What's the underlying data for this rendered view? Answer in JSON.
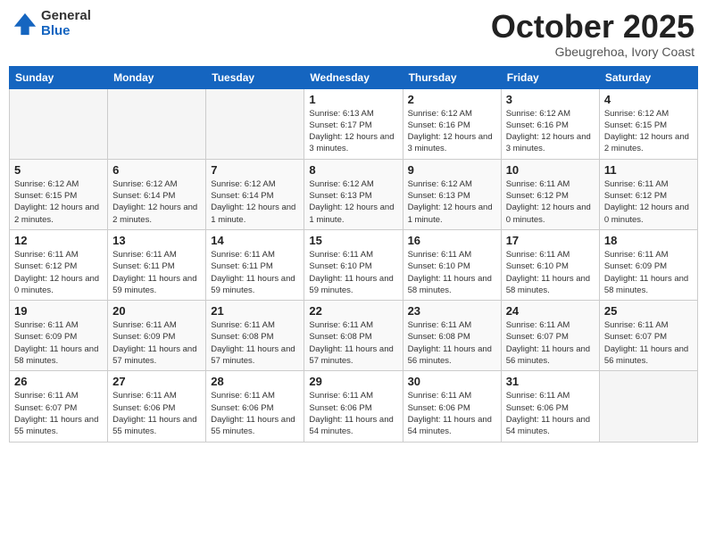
{
  "logo": {
    "general": "General",
    "blue": "Blue"
  },
  "header": {
    "month": "October 2025",
    "location": "Gbeugrehoa, Ivory Coast"
  },
  "weekdays": [
    "Sunday",
    "Monday",
    "Tuesday",
    "Wednesday",
    "Thursday",
    "Friday",
    "Saturday"
  ],
  "weeks": [
    [
      {
        "day": "",
        "sunrise": "",
        "sunset": "",
        "daylight": ""
      },
      {
        "day": "",
        "sunrise": "",
        "sunset": "",
        "daylight": ""
      },
      {
        "day": "",
        "sunrise": "",
        "sunset": "",
        "daylight": ""
      },
      {
        "day": "1",
        "sunrise": "Sunrise: 6:13 AM",
        "sunset": "Sunset: 6:17 PM",
        "daylight": "Daylight: 12 hours and 3 minutes."
      },
      {
        "day": "2",
        "sunrise": "Sunrise: 6:12 AM",
        "sunset": "Sunset: 6:16 PM",
        "daylight": "Daylight: 12 hours and 3 minutes."
      },
      {
        "day": "3",
        "sunrise": "Sunrise: 6:12 AM",
        "sunset": "Sunset: 6:16 PM",
        "daylight": "Daylight: 12 hours and 3 minutes."
      },
      {
        "day": "4",
        "sunrise": "Sunrise: 6:12 AM",
        "sunset": "Sunset: 6:15 PM",
        "daylight": "Daylight: 12 hours and 2 minutes."
      }
    ],
    [
      {
        "day": "5",
        "sunrise": "Sunrise: 6:12 AM",
        "sunset": "Sunset: 6:15 PM",
        "daylight": "Daylight: 12 hours and 2 minutes."
      },
      {
        "day": "6",
        "sunrise": "Sunrise: 6:12 AM",
        "sunset": "Sunset: 6:14 PM",
        "daylight": "Daylight: 12 hours and 2 minutes."
      },
      {
        "day": "7",
        "sunrise": "Sunrise: 6:12 AM",
        "sunset": "Sunset: 6:14 PM",
        "daylight": "Daylight: 12 hours and 1 minute."
      },
      {
        "day": "8",
        "sunrise": "Sunrise: 6:12 AM",
        "sunset": "Sunset: 6:13 PM",
        "daylight": "Daylight: 12 hours and 1 minute."
      },
      {
        "day": "9",
        "sunrise": "Sunrise: 6:12 AM",
        "sunset": "Sunset: 6:13 PM",
        "daylight": "Daylight: 12 hours and 1 minute."
      },
      {
        "day": "10",
        "sunrise": "Sunrise: 6:11 AM",
        "sunset": "Sunset: 6:12 PM",
        "daylight": "Daylight: 12 hours and 0 minutes."
      },
      {
        "day": "11",
        "sunrise": "Sunrise: 6:11 AM",
        "sunset": "Sunset: 6:12 PM",
        "daylight": "Daylight: 12 hours and 0 minutes."
      }
    ],
    [
      {
        "day": "12",
        "sunrise": "Sunrise: 6:11 AM",
        "sunset": "Sunset: 6:12 PM",
        "daylight": "Daylight: 12 hours and 0 minutes."
      },
      {
        "day": "13",
        "sunrise": "Sunrise: 6:11 AM",
        "sunset": "Sunset: 6:11 PM",
        "daylight": "Daylight: 11 hours and 59 minutes."
      },
      {
        "day": "14",
        "sunrise": "Sunrise: 6:11 AM",
        "sunset": "Sunset: 6:11 PM",
        "daylight": "Daylight: 11 hours and 59 minutes."
      },
      {
        "day": "15",
        "sunrise": "Sunrise: 6:11 AM",
        "sunset": "Sunset: 6:10 PM",
        "daylight": "Daylight: 11 hours and 59 minutes."
      },
      {
        "day": "16",
        "sunrise": "Sunrise: 6:11 AM",
        "sunset": "Sunset: 6:10 PM",
        "daylight": "Daylight: 11 hours and 58 minutes."
      },
      {
        "day": "17",
        "sunrise": "Sunrise: 6:11 AM",
        "sunset": "Sunset: 6:10 PM",
        "daylight": "Daylight: 11 hours and 58 minutes."
      },
      {
        "day": "18",
        "sunrise": "Sunrise: 6:11 AM",
        "sunset": "Sunset: 6:09 PM",
        "daylight": "Daylight: 11 hours and 58 minutes."
      }
    ],
    [
      {
        "day": "19",
        "sunrise": "Sunrise: 6:11 AM",
        "sunset": "Sunset: 6:09 PM",
        "daylight": "Daylight: 11 hours and 58 minutes."
      },
      {
        "day": "20",
        "sunrise": "Sunrise: 6:11 AM",
        "sunset": "Sunset: 6:09 PM",
        "daylight": "Daylight: 11 hours and 57 minutes."
      },
      {
        "day": "21",
        "sunrise": "Sunrise: 6:11 AM",
        "sunset": "Sunset: 6:08 PM",
        "daylight": "Daylight: 11 hours and 57 minutes."
      },
      {
        "day": "22",
        "sunrise": "Sunrise: 6:11 AM",
        "sunset": "Sunset: 6:08 PM",
        "daylight": "Daylight: 11 hours and 57 minutes."
      },
      {
        "day": "23",
        "sunrise": "Sunrise: 6:11 AM",
        "sunset": "Sunset: 6:08 PM",
        "daylight": "Daylight: 11 hours and 56 minutes."
      },
      {
        "day": "24",
        "sunrise": "Sunrise: 6:11 AM",
        "sunset": "Sunset: 6:07 PM",
        "daylight": "Daylight: 11 hours and 56 minutes."
      },
      {
        "day": "25",
        "sunrise": "Sunrise: 6:11 AM",
        "sunset": "Sunset: 6:07 PM",
        "daylight": "Daylight: 11 hours and 56 minutes."
      }
    ],
    [
      {
        "day": "26",
        "sunrise": "Sunrise: 6:11 AM",
        "sunset": "Sunset: 6:07 PM",
        "daylight": "Daylight: 11 hours and 55 minutes."
      },
      {
        "day": "27",
        "sunrise": "Sunrise: 6:11 AM",
        "sunset": "Sunset: 6:06 PM",
        "daylight": "Daylight: 11 hours and 55 minutes."
      },
      {
        "day": "28",
        "sunrise": "Sunrise: 6:11 AM",
        "sunset": "Sunset: 6:06 PM",
        "daylight": "Daylight: 11 hours and 55 minutes."
      },
      {
        "day": "29",
        "sunrise": "Sunrise: 6:11 AM",
        "sunset": "Sunset: 6:06 PM",
        "daylight": "Daylight: 11 hours and 54 minutes."
      },
      {
        "day": "30",
        "sunrise": "Sunrise: 6:11 AM",
        "sunset": "Sunset: 6:06 PM",
        "daylight": "Daylight: 11 hours and 54 minutes."
      },
      {
        "day": "31",
        "sunrise": "Sunrise: 6:11 AM",
        "sunset": "Sunset: 6:06 PM",
        "daylight": "Daylight: 11 hours and 54 minutes."
      },
      {
        "day": "",
        "sunrise": "",
        "sunset": "",
        "daylight": ""
      }
    ]
  ]
}
